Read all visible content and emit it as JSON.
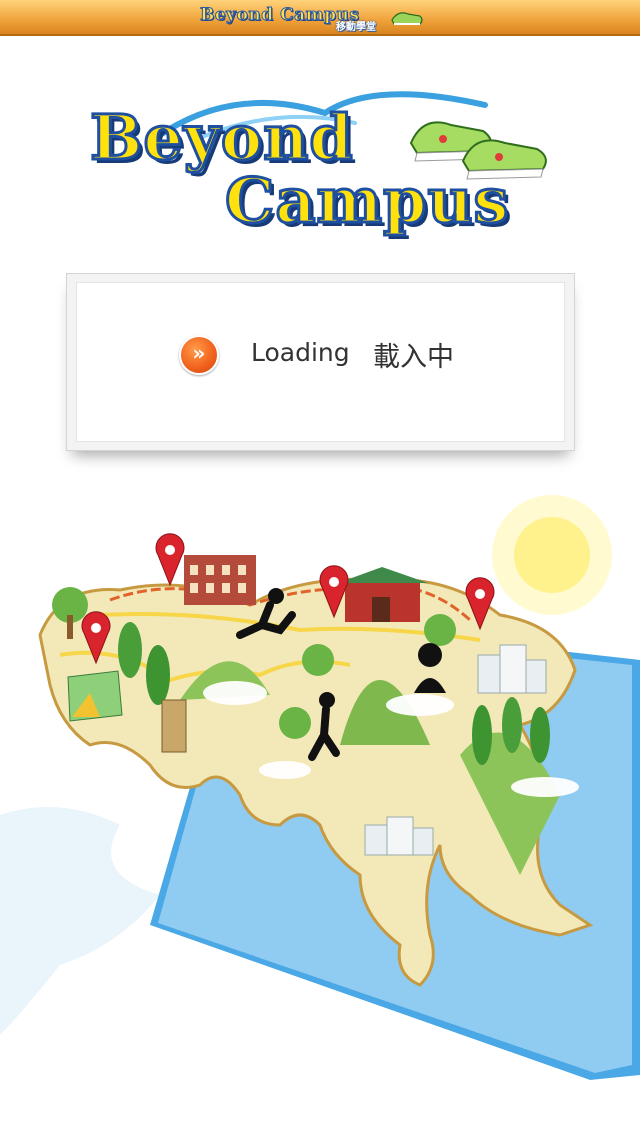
{
  "header": {
    "title": "Beyond Campus",
    "subtitle": "移動學堂"
  },
  "logo": {
    "line1": "Beyond",
    "line2": "Campus"
  },
  "loading": {
    "icon": "double-chevron-right-icon",
    "text": "Loading",
    "text_zh": "載入中"
  },
  "colors": {
    "topbar": "#f0a23a",
    "logo_text": "#ffe10e",
    "logo_outline": "#1e4fa0",
    "loading_icon": "#f0601c",
    "map_sea": "#4aa8e6",
    "map_land": "#f3e9b8",
    "map_green": "#8cc45a"
  }
}
